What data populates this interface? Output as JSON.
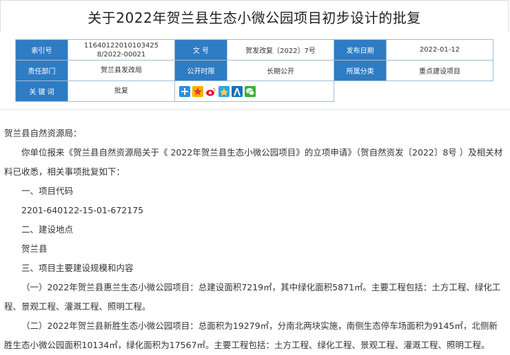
{
  "page": {
    "title": "关于2022年贺兰县生态小微公园项目初步设计的批复"
  },
  "meta": {
    "row1": {
      "k1": "索引号",
      "v1": "11640122010103425​8/2022-00021",
      "k2": "文 号",
      "v2": "贺发改复〔2022〕7号",
      "k3": "发布日期",
      "v3": "2022-01-12"
    },
    "row2": {
      "k1": "责任部门",
      "v1": "贺兰县发改局",
      "k2": "公开时限",
      "v2": "长期公开",
      "k3": "所属分类",
      "v3": "重点建设项目"
    },
    "row3": {
      "k1": "关 键 词",
      "v1": "批复"
    }
  },
  "share_icons": [
    "plus-share-icon",
    "star-share-icon",
    "weibo-share-icon",
    "qzone-share-icon",
    "renren-share-icon",
    "wechat-share-icon"
  ],
  "colors": {
    "header_cell": "#2e7cc4",
    "border": "#9fbcd6"
  },
  "content": {
    "salutation": "贺兰县自然资源局：",
    "para1": "你单位报来《贺兰县自然资源局关于《 2022年贺兰县生态小微公园项目》的立项申请》（贺自然资发〔2022〕8号 ）及相关材料已收悉，相关事项批复如下：",
    "h1": "一、项目代码",
    "code": "2201-640122-15-01-672175",
    "h2": "二、建设地点",
    "location": "贺兰县",
    "h3": "三、项目主要建设规模和内容",
    "item1": "（一）2022年贺兰县惠兰生态小微公园项目：总建设面积7219㎡，其中绿化面积5871㎡。主要工程包括：土方工程、绿化工程、景观工程、灌溉工程、照明工程。",
    "item2": "（二）2022年贺兰县新胜生态小微公园项目：总面积为19279㎡，分南北两块实施，南侧生态停车场面积为9145㎡，北侧新胜生态小微公园面积10134㎡，绿化面积为17567㎡。主要工程包括：土方工程、绿化工程、景观工程、灌溉工程、照明工程。"
  }
}
